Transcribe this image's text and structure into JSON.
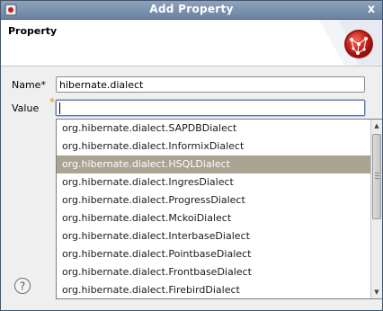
{
  "window": {
    "title": "Add Property",
    "close_glyph": "x"
  },
  "banner": {
    "title": "Property",
    "graphic_icon": "property-graphic-icon"
  },
  "form": {
    "name_label": "Name*",
    "name_value": "hibernate.dialect",
    "value_label": "Value",
    "value_value": ""
  },
  "autocomplete": {
    "items": [
      "org.hibernate.dialect.SAPDBDialect",
      "org.hibernate.dialect.InformixDialect",
      "org.hibernate.dialect.HSQLDialect",
      "org.hibernate.dialect.IngresDialect",
      "org.hibernate.dialect.ProgressDialect",
      "org.hibernate.dialect.MckoiDialect",
      "org.hibernate.dialect.InterbaseDialect",
      "org.hibernate.dialect.PointbaseDialect",
      "org.hibernate.dialect.FrontbaseDialect",
      "org.hibernate.dialect.FirebirdDialect"
    ],
    "selected_index": 2
  },
  "footer": {
    "help_icon": "help-icon"
  },
  "colors": {
    "titlebar": "#7a8fab",
    "selection": "#aaa392",
    "banner_graphic": "#c7201c"
  }
}
